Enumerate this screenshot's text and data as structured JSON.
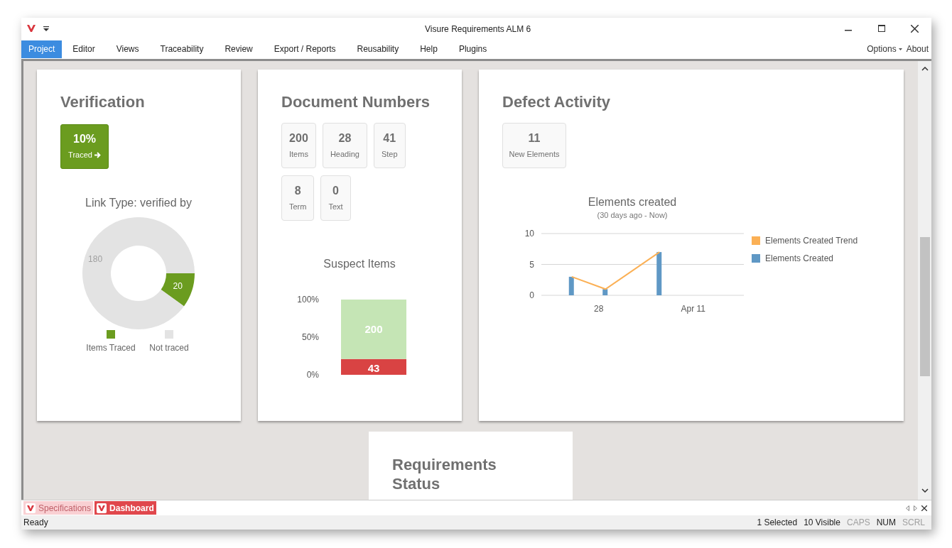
{
  "window": {
    "title": "Visure Requirements ALM 6"
  },
  "menu": {
    "items": [
      {
        "label": "Project",
        "selected": true
      },
      {
        "label": "Editor",
        "selected": false
      },
      {
        "label": "Views",
        "selected": false
      },
      {
        "label": "Traceability",
        "selected": false
      },
      {
        "label": "Review",
        "selected": false
      },
      {
        "label": "Export / Reports",
        "selected": false
      },
      {
        "label": "Reusability",
        "selected": false
      },
      {
        "label": "Help",
        "selected": false
      },
      {
        "label": "Plugins",
        "selected": false
      }
    ],
    "right": [
      "Options",
      "About"
    ]
  },
  "verification": {
    "title": "Verification",
    "tile": {
      "value": "10%",
      "label": "Traced"
    },
    "chart_data": {
      "type": "donut",
      "title": "Link Type:  verified by",
      "categories": [
        "Items Traced",
        "Not traced"
      ],
      "values": [
        20,
        180
      ],
      "colors": [
        "#6b9c1f",
        "#e3e3e3"
      ],
      "data_labels": true,
      "legend": true
    }
  },
  "document_numbers": {
    "title": "Document Numbers",
    "tiles": [
      {
        "value": "200",
        "label": "Items"
      },
      {
        "value": "28",
        "label": "Heading"
      },
      {
        "value": "41",
        "label": "Step"
      },
      {
        "value": "8",
        "label": "Term"
      },
      {
        "value": "0",
        "label": "Text"
      }
    ],
    "chart_data": {
      "type": "bar",
      "title": "Suspect Items",
      "series": [
        {
          "color": "#d94343",
          "values": [
            21
          ]
        },
        {
          "color": "#c5e5b5",
          "values": [
            79
          ]
        }
      ],
      "ylim": [
        0,
        100
      ],
      "yticks": [
        {
          "value": 0,
          "label": "0%"
        },
        {
          "value": 50,
          "label": "50%"
        },
        {
          "value": 100,
          "label": "100%"
        }
      ],
      "stacked": true,
      "value_labels": [
        "43",
        "200"
      ]
    }
  },
  "defect_activity": {
    "title": "Defect Activity",
    "tile": {
      "value": "11",
      "label": "New Elements"
    },
    "chart_data": {
      "type": "line",
      "title": "Elements created",
      "subtitle": "(30 days ago - Now)",
      "legend": true,
      "categories": [
        null,
        null,
        null,
        null,
        null,
        null,
        null,
        null,
        "28",
        null,
        null,
        null,
        null,
        null,
        null,
        null,
        null,
        null,
        null,
        null,
        null,
        null,
        "Apr 11",
        null,
        null,
        null,
        null,
        null,
        null,
        null
      ],
      "ylim": [
        0,
        10
      ],
      "yticks": [
        {
          "value": 0,
          "label": "0"
        },
        {
          "value": 5,
          "label": "5"
        },
        {
          "value": 10,
          "label": "10"
        }
      ],
      "series": [
        {
          "name": "Elements Created Trend",
          "color": "#fbb055",
          "type": "line",
          "values": [
            null,
            null,
            null,
            null,
            3,
            null,
            null,
            null,
            null,
            1,
            null,
            null,
            null,
            null,
            null,
            null,
            null,
            7,
            null,
            null,
            null,
            null,
            null,
            null,
            null,
            null,
            null,
            null,
            null,
            null
          ]
        },
        {
          "name": "Elements Created",
          "color": "#5f98c5",
          "type": "bar",
          "values": [
            null,
            null,
            null,
            null,
            3,
            null,
            null,
            null,
            null,
            1,
            null,
            null,
            null,
            null,
            null,
            null,
            null,
            7,
            null,
            null,
            null,
            null,
            null,
            null,
            null,
            null,
            null,
            null,
            null,
            null
          ]
        }
      ]
    }
  },
  "requirements_status": {
    "title": "Requirements Status"
  },
  "doc_tabs": [
    {
      "label": "Specifications",
      "selected": false
    },
    {
      "label": "Dashboard",
      "selected": true
    }
  ],
  "status_bar": {
    "text": "Ready",
    "indicators": [
      {
        "label": "1 Selected",
        "on": true
      },
      {
        "label": "10 Visible",
        "on": true
      },
      {
        "label": "CAPS",
        "on": false
      },
      {
        "label": "NUM",
        "on": true
      },
      {
        "label": "SCRL",
        "on": false
      }
    ]
  }
}
